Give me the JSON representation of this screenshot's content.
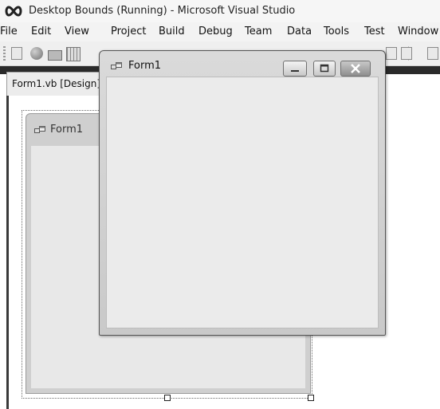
{
  "vs": {
    "title": "Desktop Bounds (Running) - Microsoft Visual Studio",
    "menu": [
      "File",
      "Edit",
      "View",
      "Project",
      "Build",
      "Debug",
      "Team",
      "Data",
      "Tools",
      "Test",
      "Window"
    ],
    "doc_tab": "Form1.vb [Design]"
  },
  "design_form": {
    "caption": "Form1"
  },
  "running_form": {
    "caption": "Form1"
  },
  "icons": {
    "vs_logo": "infinity-logo-icon",
    "form": "form-window-icon",
    "minimize": "minimize-icon",
    "maximize": "maximize-icon",
    "close": "close-icon"
  }
}
